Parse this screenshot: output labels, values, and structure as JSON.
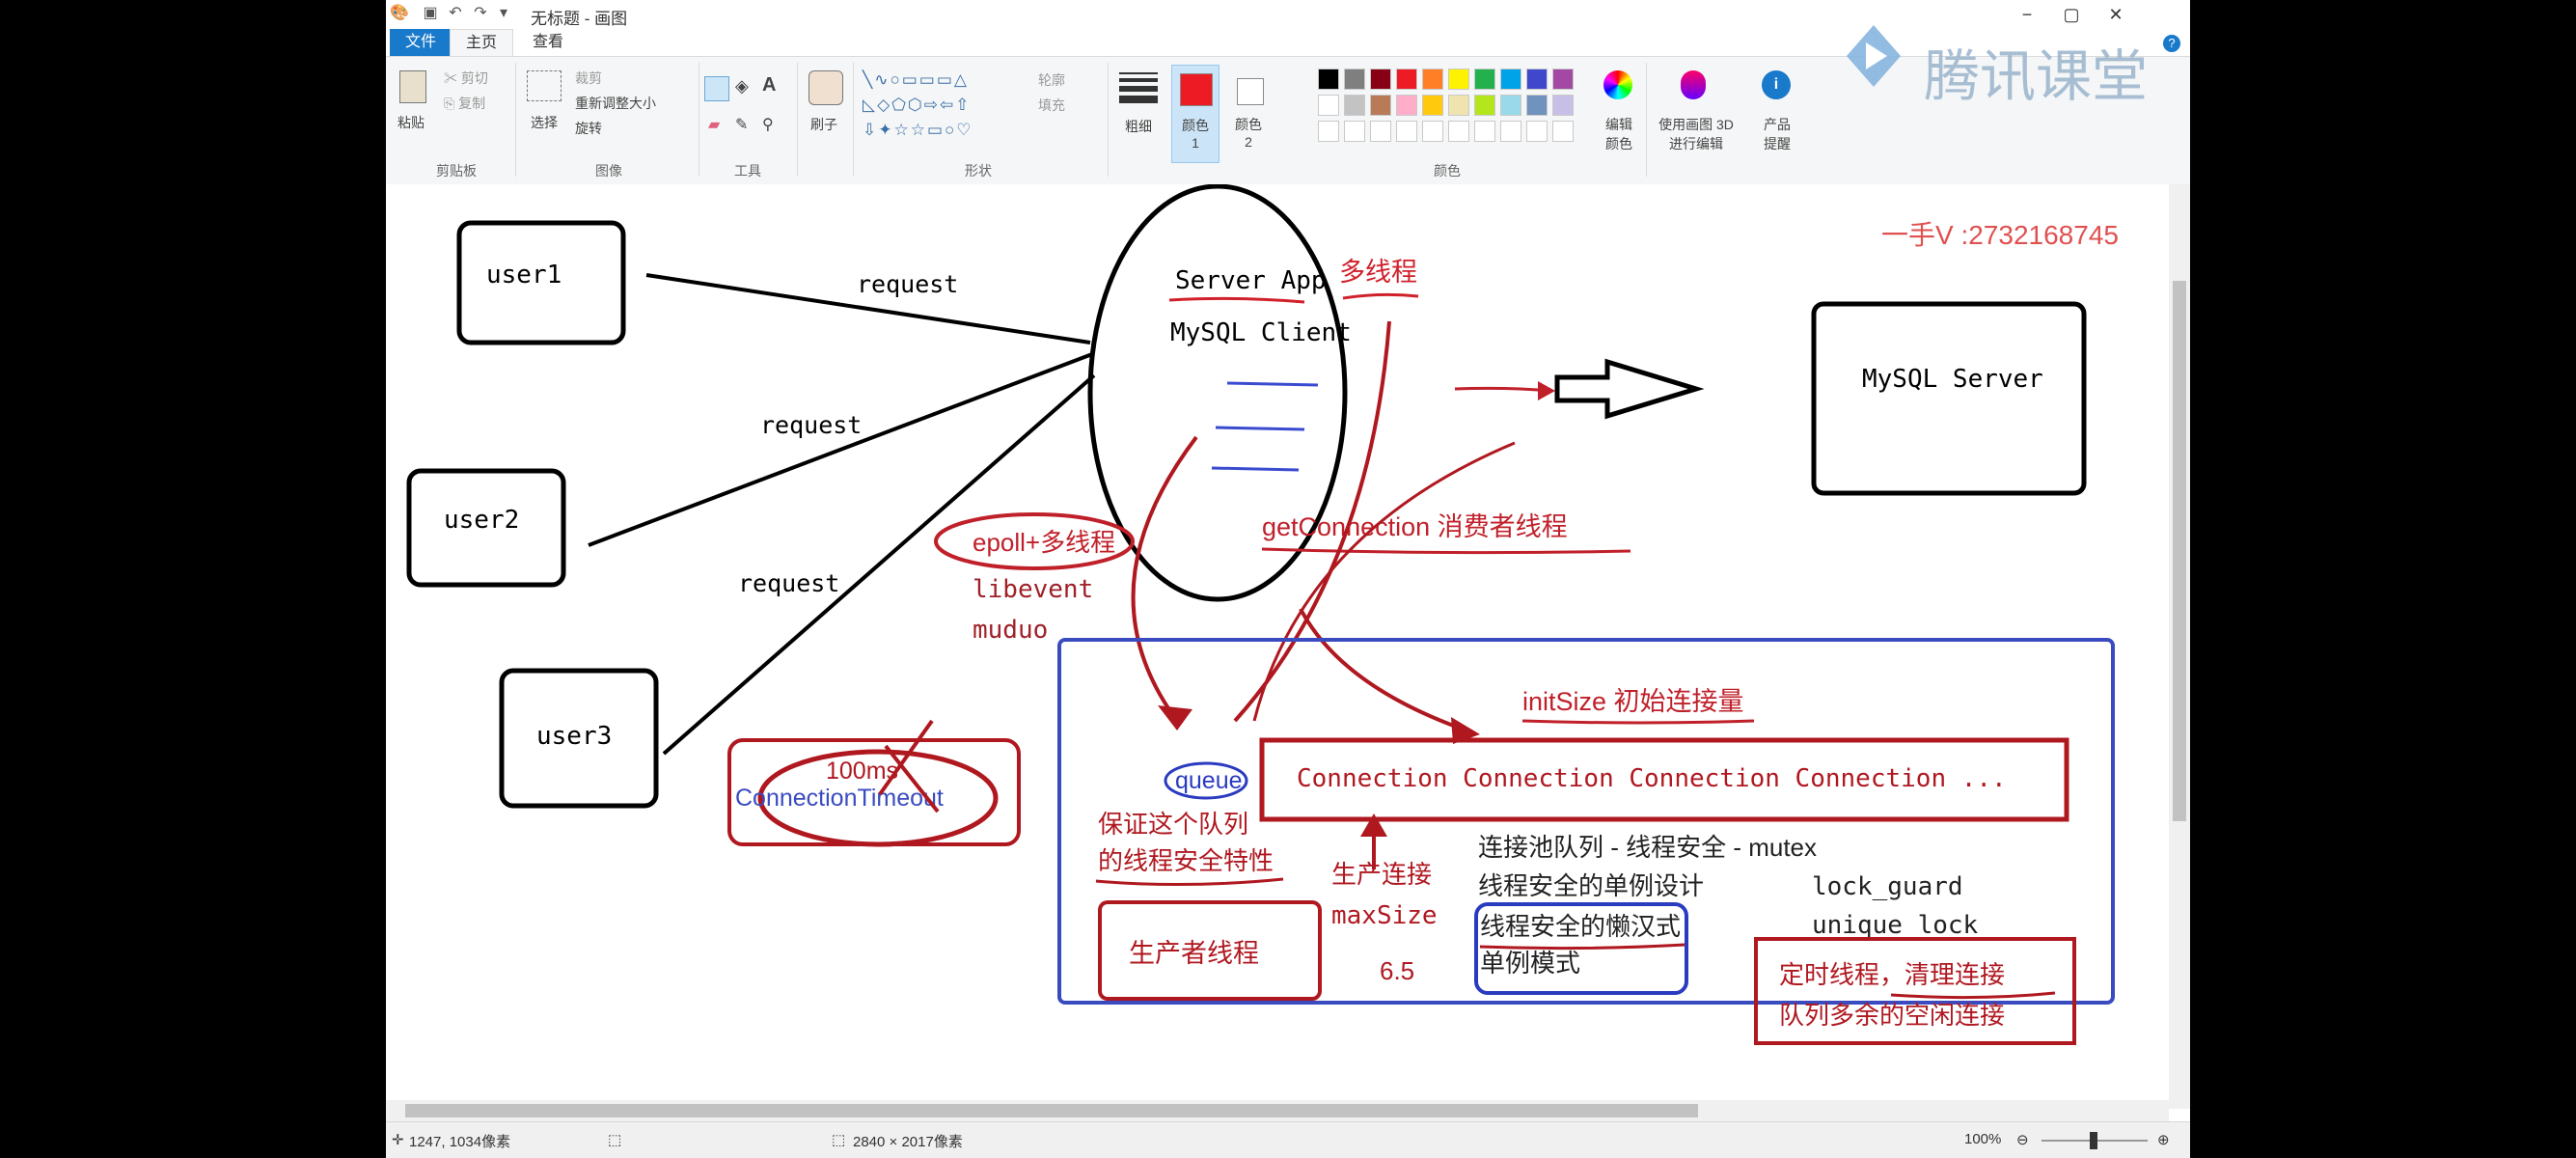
{
  "window": {
    "title": "无标题 - 画图"
  },
  "tabs": [
    {
      "label": "文件"
    },
    {
      "label": "主页"
    },
    {
      "label": "查看"
    }
  ],
  "ribbon": {
    "clipboard": {
      "paste": "粘贴",
      "cut": "剪切",
      "copy": "复制",
      "group": "剪贴板"
    },
    "image": {
      "select": "选择",
      "crop": "裁剪",
      "resize": "重新调整大小",
      "rotate": "旋转",
      "group": "图像"
    },
    "tools": {
      "group": "工具"
    },
    "brushes": {
      "label": "刷子"
    },
    "shapes": {
      "outline": "轮廓",
      "fill": "填充",
      "group": "形状"
    },
    "size": {
      "label": "粗细"
    },
    "color1": {
      "label": "颜色 1",
      "value": "#ed1c24"
    },
    "color2": {
      "label": "颜色 2",
      "value": "#ffffff"
    },
    "colors": {
      "group": "颜色",
      "edit": "编辑颜色"
    },
    "paint3d": {
      "label": "使用画图 3D 进行编辑"
    },
    "product_alert": {
      "label": "产品提醒"
    }
  },
  "palette": {
    "row1": [
      "#000000",
      "#7f7f7f",
      "#880015",
      "#ed1c24",
      "#ff7f27",
      "#fff200",
      "#22b14c",
      "#00a2e8",
      "#3f48cc",
      "#a349a4"
    ],
    "row2": [
      "#ffffff",
      "#c3c3c3",
      "#b97a57",
      "#ffaec9",
      "#ffc90e",
      "#efe4b0",
      "#b5e61d",
      "#99d9ea",
      "#7092be",
      "#c8bfe7"
    ]
  },
  "watermark": {
    "text": "腾讯课堂"
  },
  "canvas": {
    "contact": "一手V :2732168745",
    "users": [
      "user1",
      "user2",
      "user3"
    ],
    "request": [
      "request",
      "request",
      "request"
    ],
    "server": {
      "line1": "Server App",
      "multi": "多线程",
      "line2": "MySQL Client"
    },
    "mysql_server": "MySQL Server",
    "epoll": "epoll+多线程",
    "libevent": "libevent",
    "muduo": "muduo",
    "get_connection": "getConnection 消费者线程",
    "timeout": {
      "ms": "100ms",
      "label": "ConnectionTimeout"
    },
    "init_size": "initSize 初始连接量",
    "queue": "queue",
    "connections": "Connection Connection Connection Connection ...",
    "queue_note_1": "保证这个队列",
    "queue_note_2": "的线程安全特性",
    "produce": "生产连接",
    "max_size": "maxSize",
    "hand_note": "6.5",
    "producer": "生产者线程",
    "pool_queue": "连接池队列  - 线程安全 - mutex",
    "singleton": "线程安全的单例设计",
    "lock_guard": "lock_guard",
    "unique_lock": "unique_lock",
    "lazy_1": "线程安全的懒汉式",
    "lazy_2": "单例模式",
    "timer_1": "定时线程，清理连接",
    "timer_2": "队列多余的空闲连接"
  },
  "status": {
    "cursor": "1247, 1034像素",
    "size": "2840 × 2017像素",
    "zoom": "100%"
  }
}
